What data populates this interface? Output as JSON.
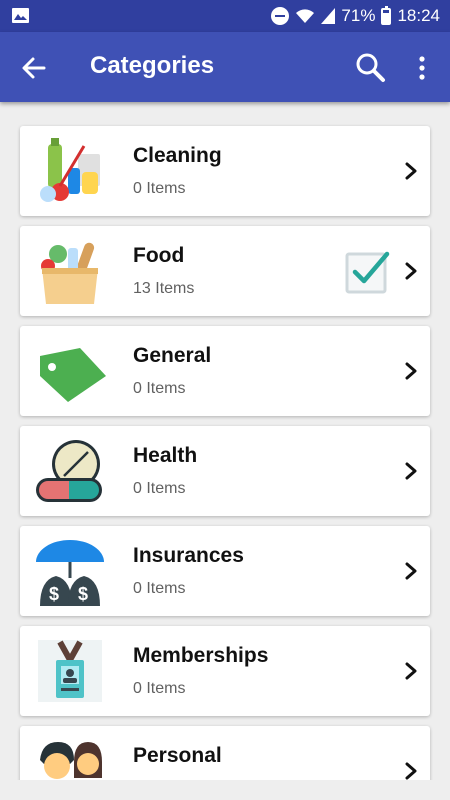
{
  "status": {
    "battery": "71%",
    "time": "18:24",
    "battery_level": 0.71
  },
  "appbar": {
    "title": "Categories"
  },
  "categories": [
    {
      "name": "Cleaning",
      "count": "0 Items",
      "icon": "cleaning-supplies-icon",
      "checked": false
    },
    {
      "name": "Food",
      "count": "13 Items",
      "icon": "grocery-bag-icon",
      "checked": true
    },
    {
      "name": "General",
      "count": "0 Items",
      "icon": "tag-icon",
      "checked": false
    },
    {
      "name": "Health",
      "count": "0 Items",
      "icon": "pills-icon",
      "checked": false
    },
    {
      "name": "Insurances",
      "count": "0 Items",
      "icon": "umbrella-money-icon",
      "checked": false
    },
    {
      "name": "Memberships",
      "count": "0 Items",
      "icon": "id-badge-icon",
      "checked": false
    },
    {
      "name": "Personal",
      "count": "",
      "icon": "people-icon",
      "checked": false
    }
  ],
  "colors": {
    "primary": "#3f51b5",
    "primary_dark": "#303f9f",
    "check": "#26a69a",
    "tag": "#4caf50"
  }
}
